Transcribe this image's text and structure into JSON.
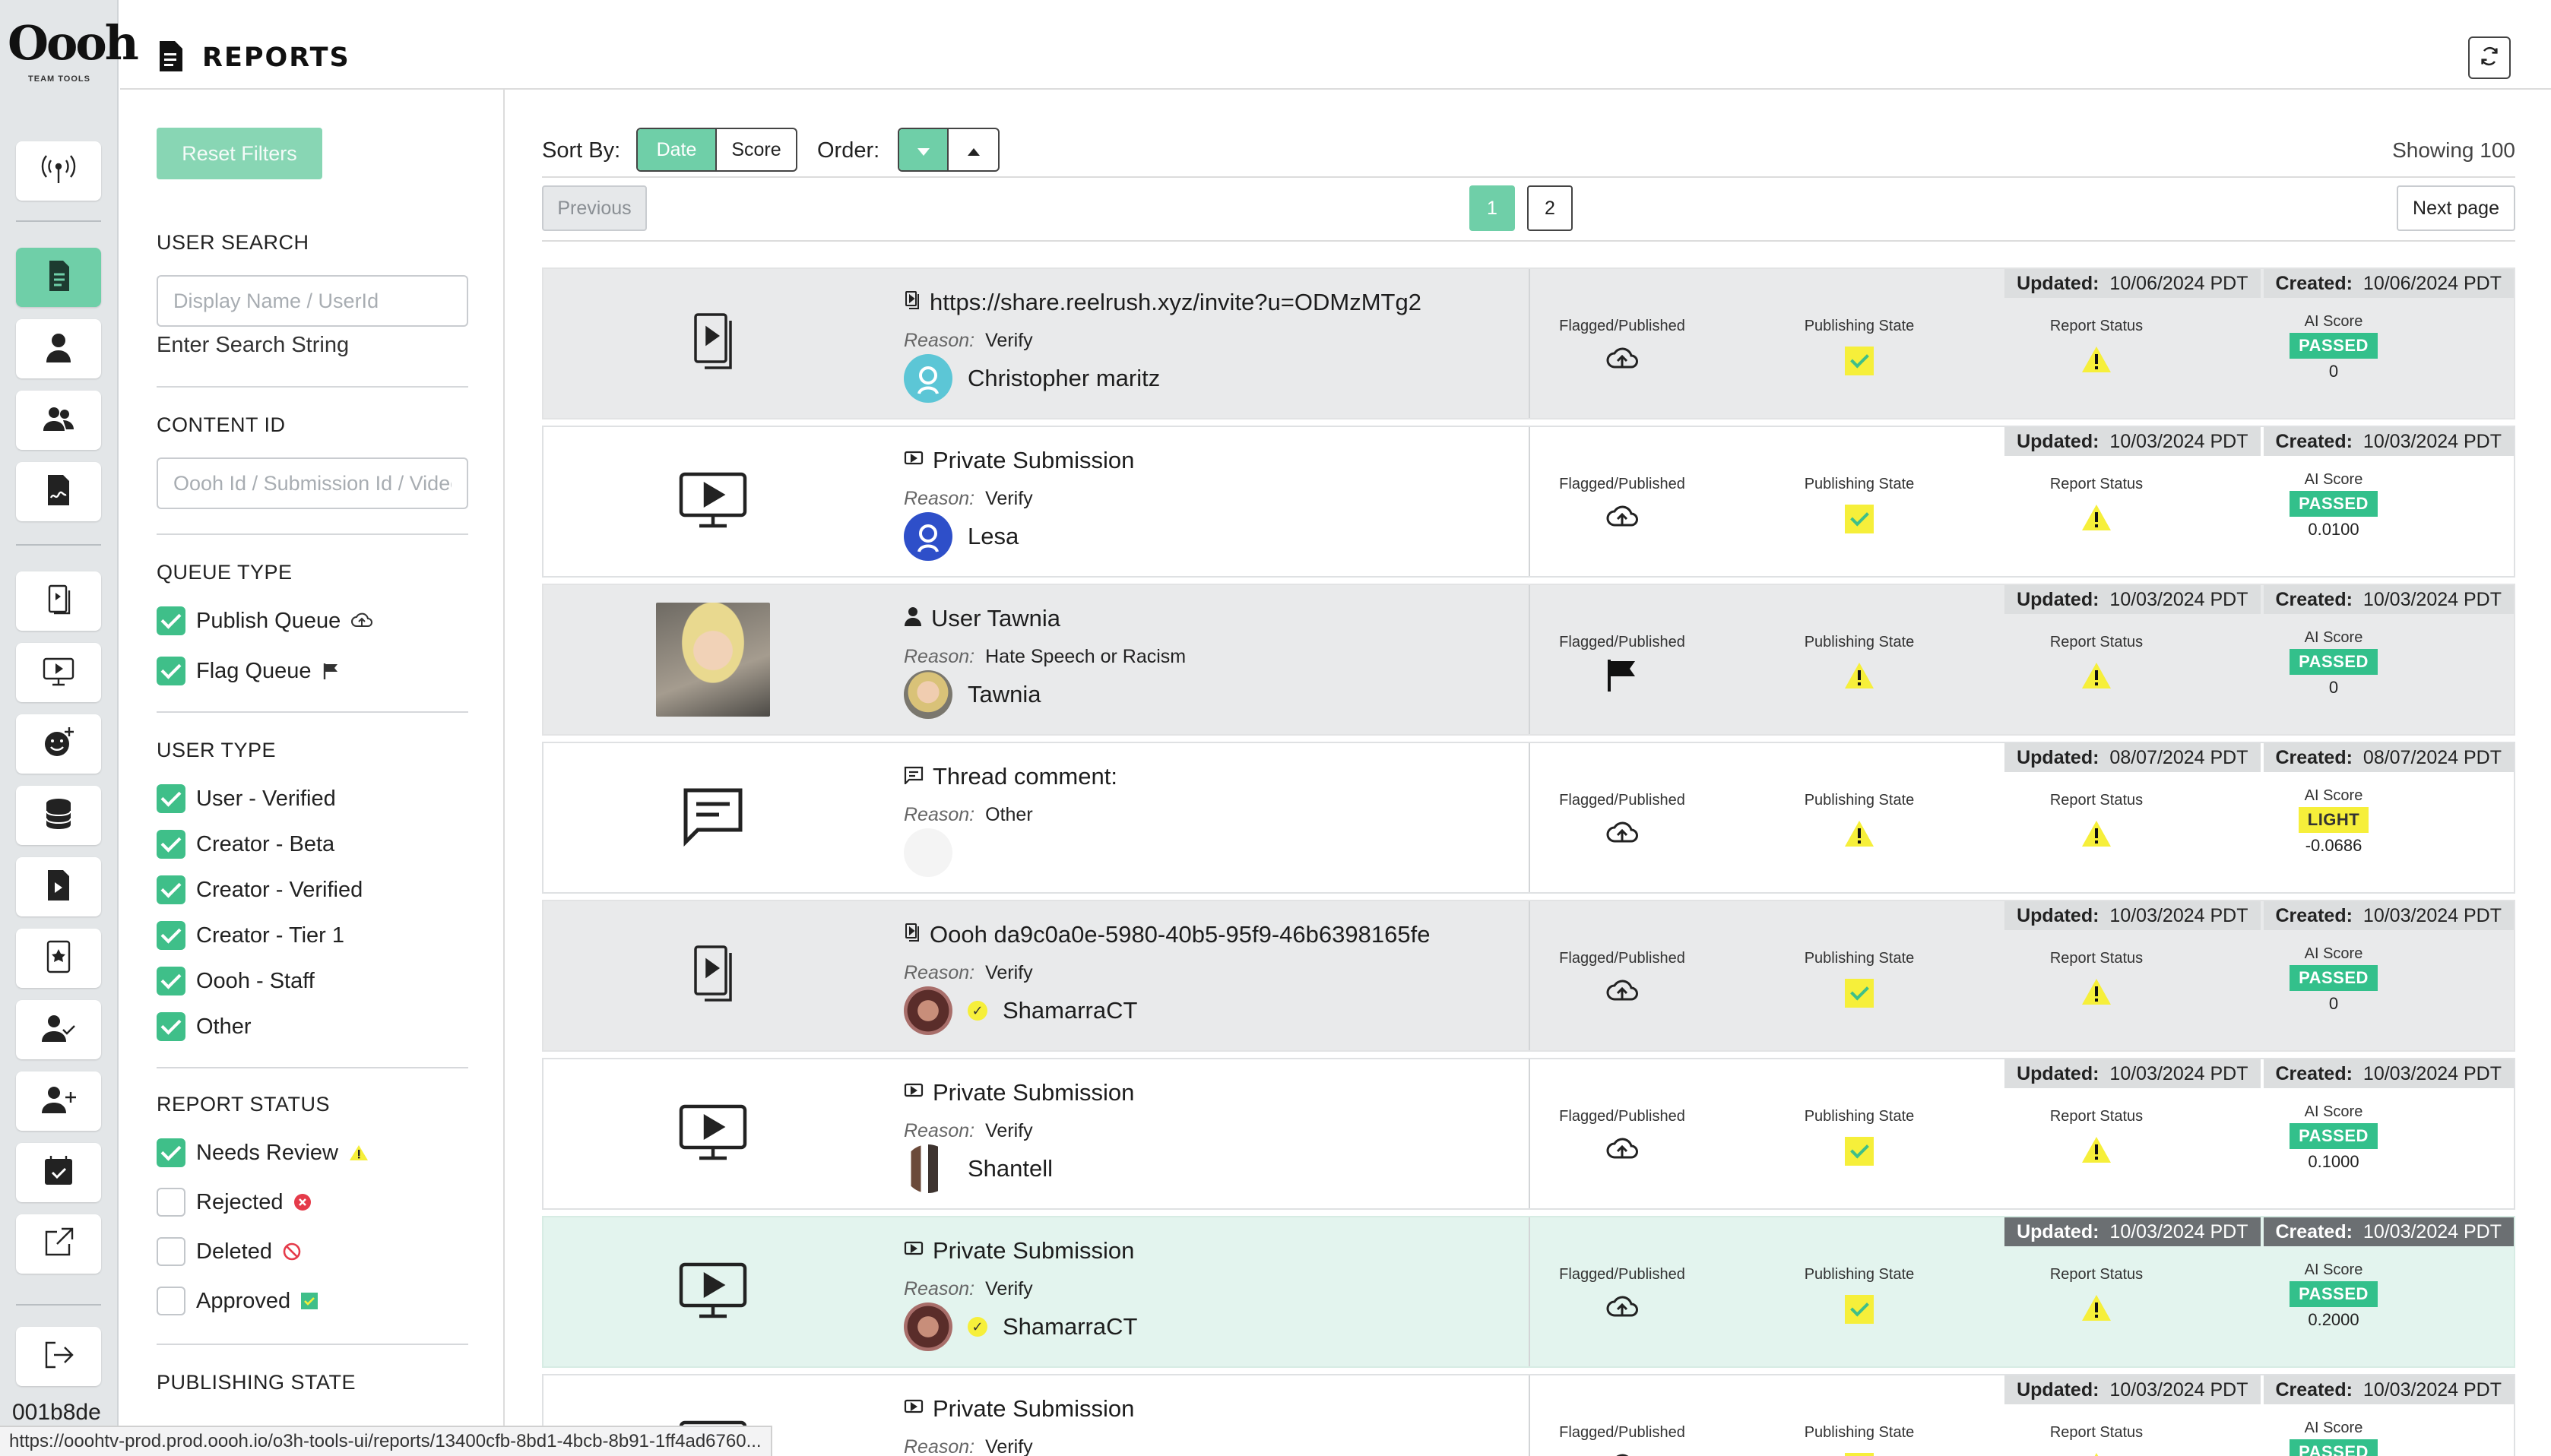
{
  "app": {
    "logo_text": "Oooh",
    "logo_sub": "TEAM TOOLS",
    "page_title": "REPORTS",
    "build_id": "001b8de"
  },
  "rail": [
    {
      "name": "antenna-icon",
      "active": false
    },
    {
      "name": "reports-icon",
      "active": true
    },
    {
      "name": "user-icon",
      "active": false
    },
    {
      "name": "users-icon",
      "active": false
    },
    {
      "name": "signature-icon",
      "active": false
    },
    {
      "name": "content-icon",
      "active": false
    },
    {
      "name": "video-icon",
      "active": false
    },
    {
      "name": "emoji-add-icon",
      "active": false
    },
    {
      "name": "database-icon",
      "active": false
    },
    {
      "name": "file-video-icon",
      "active": false
    },
    {
      "name": "badge-icon",
      "active": false
    },
    {
      "name": "user-check-icon",
      "active": false
    },
    {
      "name": "user-plus-icon",
      "active": false
    },
    {
      "name": "calendar-check-icon",
      "active": false
    },
    {
      "name": "external-link-icon",
      "active": false
    },
    {
      "name": "logout-icon",
      "active": false
    }
  ],
  "filters": {
    "reset_label": "Reset Filters",
    "user_search": {
      "heading": "USER SEARCH",
      "placeholder": "Display Name / UserId",
      "note": "Enter Search String"
    },
    "content_id": {
      "heading": "CONTENT ID",
      "placeholder": "Oooh Id / Submission Id / Video Id"
    },
    "queue_type": {
      "heading": "QUEUE TYPE",
      "items": [
        {
          "label": "Publish Queue",
          "checked": true,
          "icon": "cloud-upload-icon"
        },
        {
          "label": "Flag Queue",
          "checked": true,
          "icon": "flag-icon"
        }
      ]
    },
    "user_type": {
      "heading": "USER TYPE",
      "items": [
        {
          "label": "User - Verified",
          "checked": true
        },
        {
          "label": "Creator - Beta",
          "checked": true
        },
        {
          "label": "Creator - Verified",
          "checked": true
        },
        {
          "label": "Creator - Tier 1",
          "checked": true
        },
        {
          "label": "Oooh - Staff",
          "checked": true
        },
        {
          "label": "Other",
          "checked": true
        }
      ]
    },
    "report_status": {
      "heading": "REPORT STATUS",
      "items": [
        {
          "label": "Needs Review",
          "checked": true,
          "icon": "warning-icon"
        },
        {
          "label": "Rejected",
          "checked": false,
          "icon": "rejected-icon"
        },
        {
          "label": "Deleted",
          "checked": false,
          "icon": "deleted-icon"
        },
        {
          "label": "Approved",
          "checked": false,
          "icon": "approved-icon"
        }
      ]
    },
    "publishing_state": {
      "heading": "PUBLISHING STATE"
    }
  },
  "toolbar": {
    "sort_by_label": "Sort By:",
    "sort_options": [
      "Date",
      "Score"
    ],
    "sort_selected": "Date",
    "order_label": "Order:",
    "showing": "Showing 100",
    "previous_label": "Previous",
    "pages": [
      "1",
      "2"
    ],
    "current_page": "1",
    "next_label": "Next page"
  },
  "stat_labels": {
    "flagged": "Flagged/Published",
    "publishing": "Publishing State",
    "report": "Report Status",
    "ai": "AI Score"
  },
  "date_labels": {
    "updated": "Updated:",
    "created": "Created:"
  },
  "reason_label": "Reason:",
  "reports": [
    {
      "thumb": "content",
      "title_icon": "content-icon",
      "title": "https://share.reelrush.xyz/invite?u=ODMzMTg2",
      "reason": "Verify",
      "user": "Christopher maritz",
      "avatar": "teal",
      "verified": false,
      "flagged": "cloud",
      "publishing": "check",
      "report": "warning",
      "ai_badge": "PASSED",
      "ai_score": "0",
      "updated": "10/06/2024 PDT",
      "created": "10/06/2024 PDT",
      "style": "grey"
    },
    {
      "thumb": "video",
      "title_icon": "video-icon",
      "title": "Private Submission",
      "reason": "Verify",
      "user": "Lesa",
      "avatar": "blue",
      "verified": false,
      "flagged": "cloud",
      "publishing": "check",
      "report": "warning",
      "ai_badge": "PASSED",
      "ai_score": "0.0100",
      "updated": "10/03/2024 PDT",
      "created": "10/03/2024 PDT",
      "style": "white"
    },
    {
      "thumb": "photo",
      "title_icon": "user-icon",
      "title": "User Tawnia",
      "reason": "Hate Speech or Racism",
      "user": "Tawnia",
      "avatar": "photo",
      "verified": false,
      "flagged": "flag",
      "publishing": "warning",
      "report": "warning",
      "ai_badge": "PASSED",
      "ai_score": "0",
      "updated": "10/03/2024 PDT",
      "created": "10/03/2024 PDT",
      "style": "grey"
    },
    {
      "thumb": "comment",
      "title_icon": "comment-icon",
      "title": "Thread comment:",
      "reason": "Other",
      "user": "",
      "avatar": "none",
      "verified": false,
      "flagged": "cloud",
      "publishing": "warning",
      "report": "warning",
      "ai_badge": "LIGHT",
      "ai_score": "-0.0686",
      "updated": "08/07/2024 PDT",
      "created": "08/07/2024 PDT",
      "style": "white"
    },
    {
      "thumb": "content",
      "title_icon": "content-icon",
      "title": "Oooh da9c0a0e-5980-40b5-95f9-46b6398165fe",
      "reason": "Verify",
      "user": "ShamarraCT",
      "avatar": "photo2",
      "verified": true,
      "flagged": "cloud",
      "publishing": "check",
      "report": "warning",
      "ai_badge": "PASSED",
      "ai_score": "0",
      "updated": "10/03/2024 PDT",
      "created": "10/03/2024 PDT",
      "style": "grey"
    },
    {
      "thumb": "video",
      "title_icon": "video-icon",
      "title": "Private Submission",
      "reason": "Verify",
      "user": "Shantell",
      "avatar": "photo3",
      "verified": false,
      "flagged": "cloud",
      "publishing": "check",
      "report": "warning",
      "ai_badge": "PASSED",
      "ai_score": "0.1000",
      "updated": "10/03/2024 PDT",
      "created": "10/03/2024 PDT",
      "style": "white"
    },
    {
      "thumb": "video",
      "title_icon": "video-icon",
      "title": "Private Submission",
      "reason": "Verify",
      "user": "ShamarraCT",
      "avatar": "photo2",
      "verified": true,
      "flagged": "cloud",
      "publishing": "check",
      "report": "warning",
      "ai_badge": "PASSED",
      "ai_score": "0.2000",
      "updated": "10/03/2024 PDT",
      "created": "10/03/2024 PDT",
      "style": "green"
    },
    {
      "thumb": "video",
      "title_icon": "video-icon",
      "title": "Private Submission",
      "reason": "Verify",
      "user": "",
      "avatar": "none",
      "verified": false,
      "flagged": "cloud",
      "publishing": "check",
      "report": "warning",
      "ai_badge": "PASSED",
      "ai_score": "",
      "updated": "10/03/2024 PDT",
      "created": "10/03/2024 PDT",
      "style": "white"
    }
  ],
  "status_url": "https://ooohtv-prod.prod.oooh.io/o3h-tools-ui/reports/13400cfb-8bd1-4bcb-8b91-1ff4ad6760..."
}
